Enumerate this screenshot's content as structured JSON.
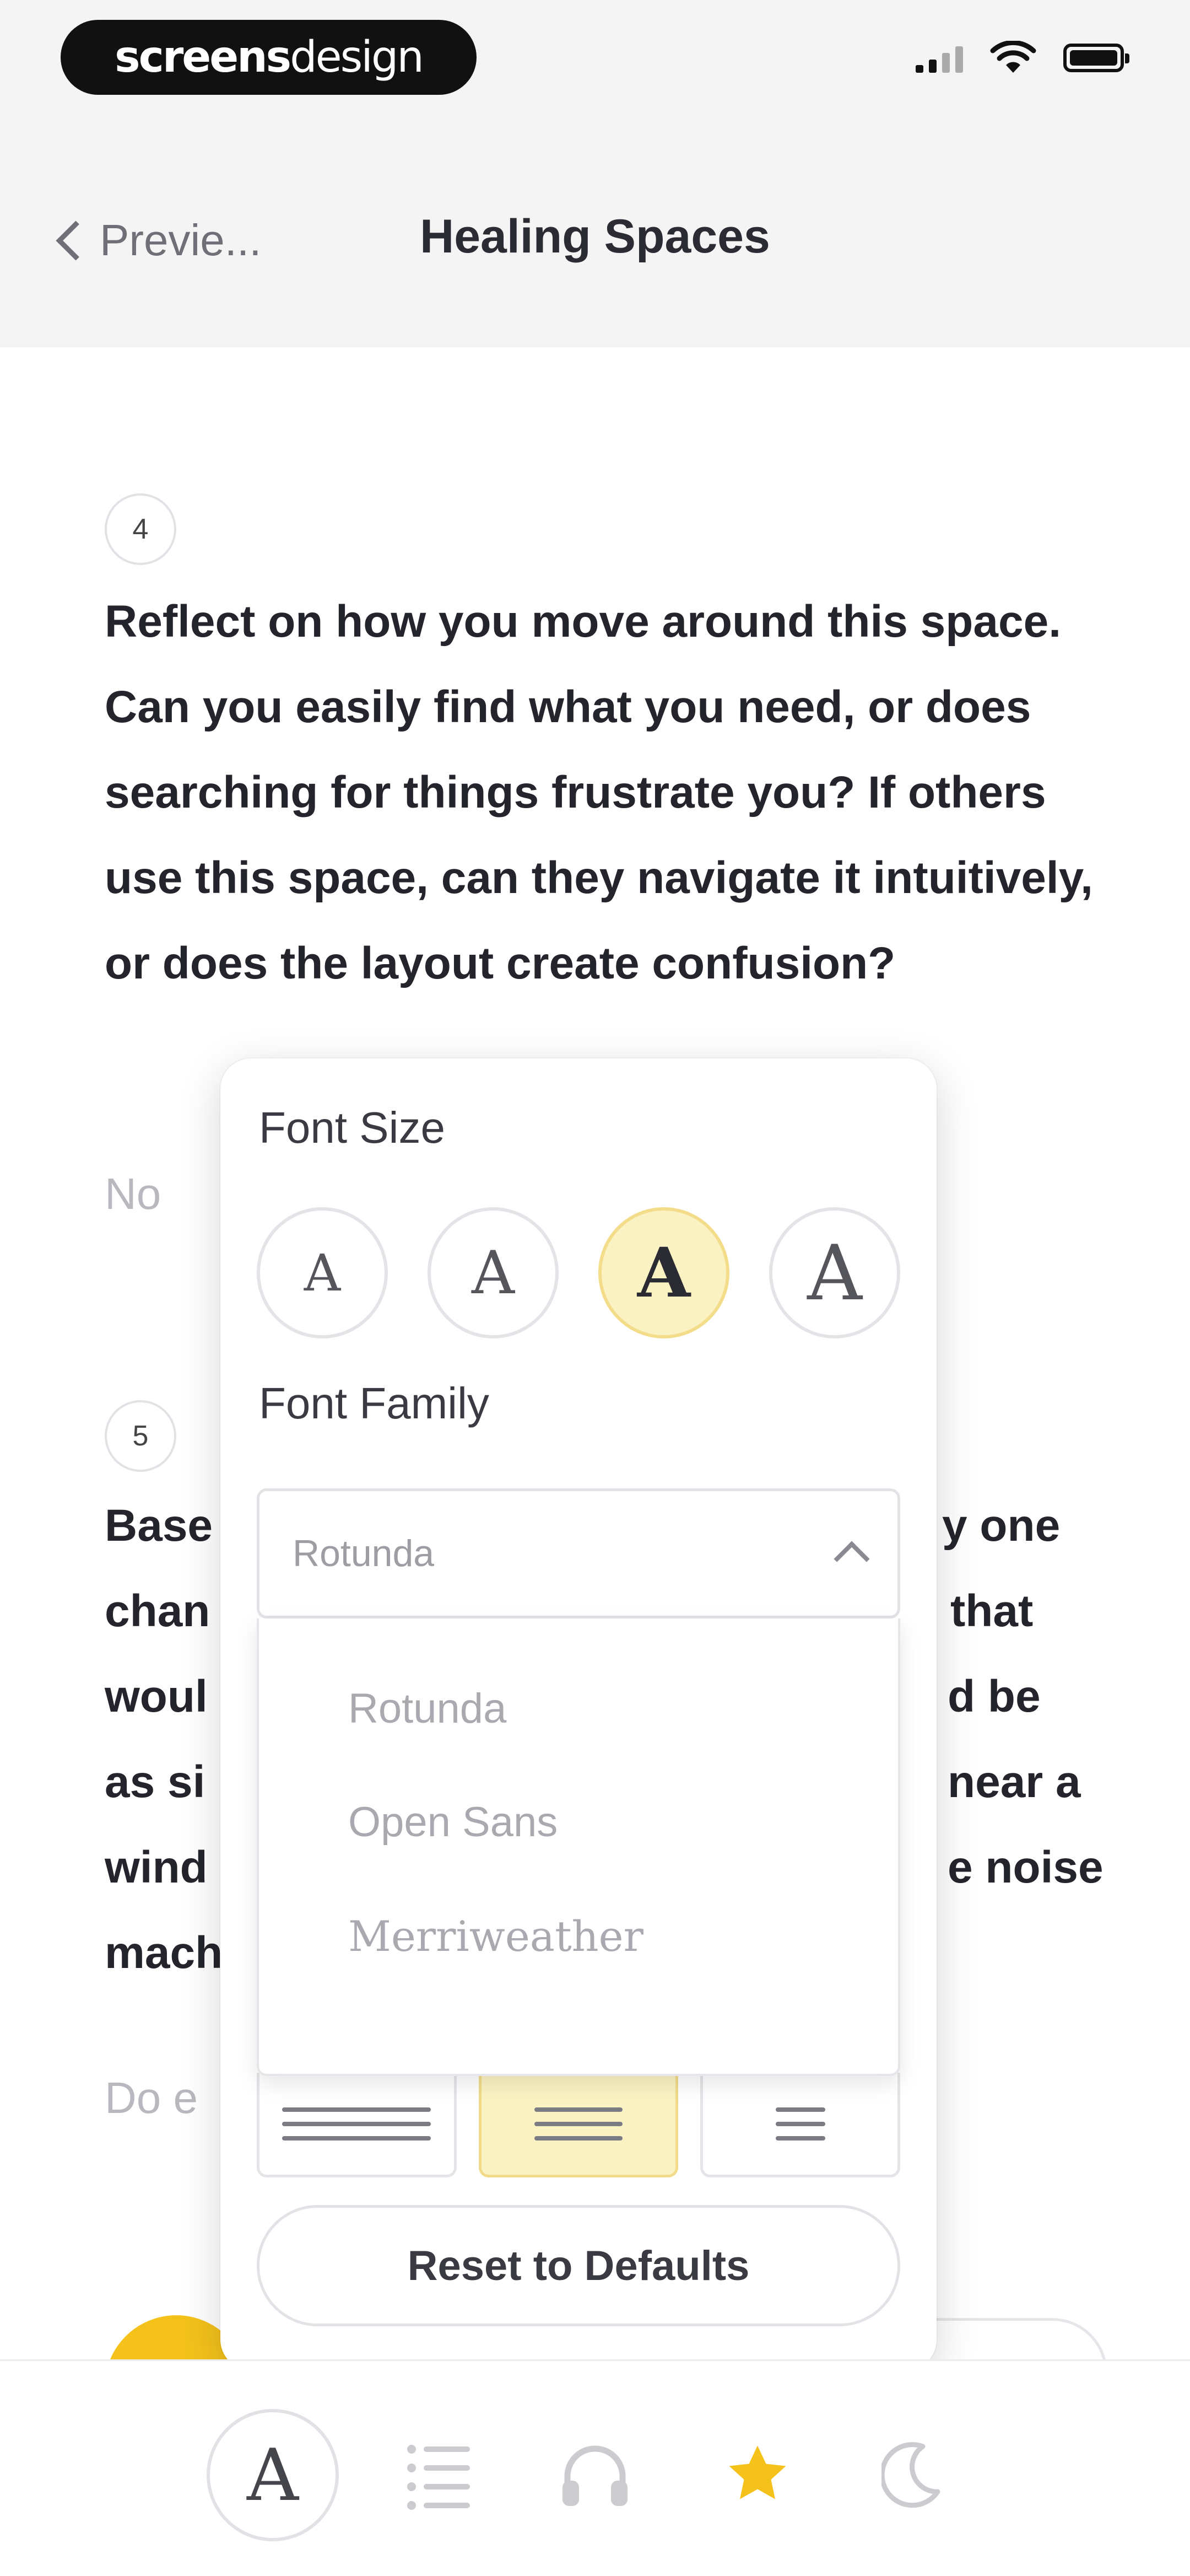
{
  "status_bar": {
    "brand_bold": "screens",
    "brand_light": "design"
  },
  "header": {
    "back_label": "Previe...",
    "title": "Healing Spaces"
  },
  "questions": [
    {
      "number": "4",
      "text": "Reflect on how you move around this space. Can you easily find what you need, or does searching for things frustrate you? If others use this space, can they navigate it intuitively, or does the layout create confusion?",
      "answer_placeholder": "No"
    },
    {
      "number": "5",
      "text_fragments": [
        "Base",
        "y one",
        "chan",
        "that",
        "woul",
        "d be",
        "as si",
        "near a",
        "wind",
        "e noise",
        "mach"
      ],
      "answer_placeholder": "Do e"
    }
  ],
  "popup": {
    "font_size_label": "Font Size",
    "font_size_options": [
      "A",
      "A",
      "A",
      "A"
    ],
    "font_size_selected_index": 2,
    "font_family_label": "Font Family",
    "font_family_value": "Rotunda",
    "font_family_options": [
      "Rotunda",
      "Open Sans",
      "Merriweather"
    ],
    "line_spacing_selected_index": 1,
    "reset_label": "Reset to Defaults"
  },
  "tabbar": {
    "font_tab_glyph": "A",
    "active_tab": "favorites"
  },
  "colors": {
    "accent_yellow": "#f4c21b",
    "selected_bg": "#fbf2c3",
    "text_dark": "#24242c",
    "muted": "#b8b8be"
  }
}
